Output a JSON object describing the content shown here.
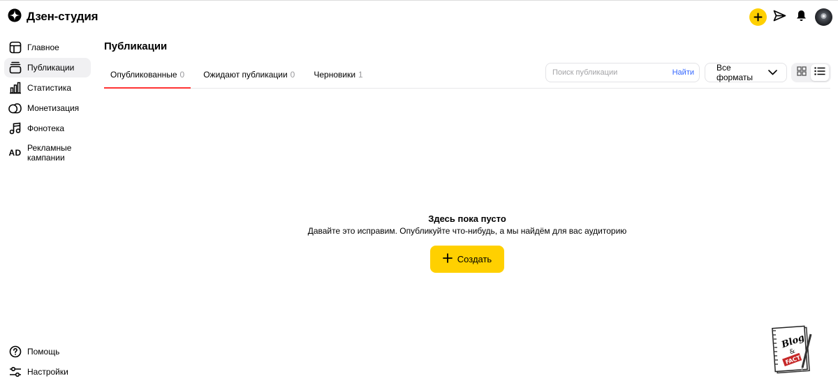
{
  "app": {
    "title": "Дзен-студия"
  },
  "header": {
    "icons": [
      "plus-icon",
      "send-icon",
      "bell-icon",
      "avatar"
    ],
    "accent_color": "#ffd000"
  },
  "sidebar": {
    "items": [
      {
        "label": "Главное",
        "icon": "dashboard-icon",
        "active": false
      },
      {
        "label": "Публикации",
        "icon": "publications-icon",
        "active": true
      },
      {
        "label": "Статистика",
        "icon": "chart-icon",
        "active": false
      },
      {
        "label": "Монетизация",
        "icon": "coins-icon",
        "active": false
      },
      {
        "label": "Фонотека",
        "icon": "music-icon",
        "active": false
      },
      {
        "label": "Рекламные кампании",
        "icon_text": "AD",
        "active": false
      }
    ],
    "bottom": [
      {
        "label": "Помощь",
        "icon": "help-icon"
      },
      {
        "label": "Настройки",
        "icon": "settings-icon"
      }
    ]
  },
  "main": {
    "title": "Публикации",
    "tabs": [
      {
        "label": "Опубликованные",
        "count": "0",
        "active": true
      },
      {
        "label": "Ожидают публикации",
        "count": "0",
        "active": false
      },
      {
        "label": "Черновики",
        "count": "1",
        "active": false
      }
    ],
    "search": {
      "placeholder": "Поиск публикации",
      "value": "",
      "button": "Найти"
    },
    "format_filter": {
      "selected": "Все форматы"
    },
    "view_mode": "list",
    "empty_state": {
      "title": "Здесь пока пусто",
      "text": "Давайте это исправим. Опубликуйте что-нибудь, а мы найдём для вас аудиторию",
      "button": "Создать"
    }
  },
  "watermark": {
    "text_top": "Blog",
    "text_mid": "&",
    "text_bottom": "FACT"
  }
}
